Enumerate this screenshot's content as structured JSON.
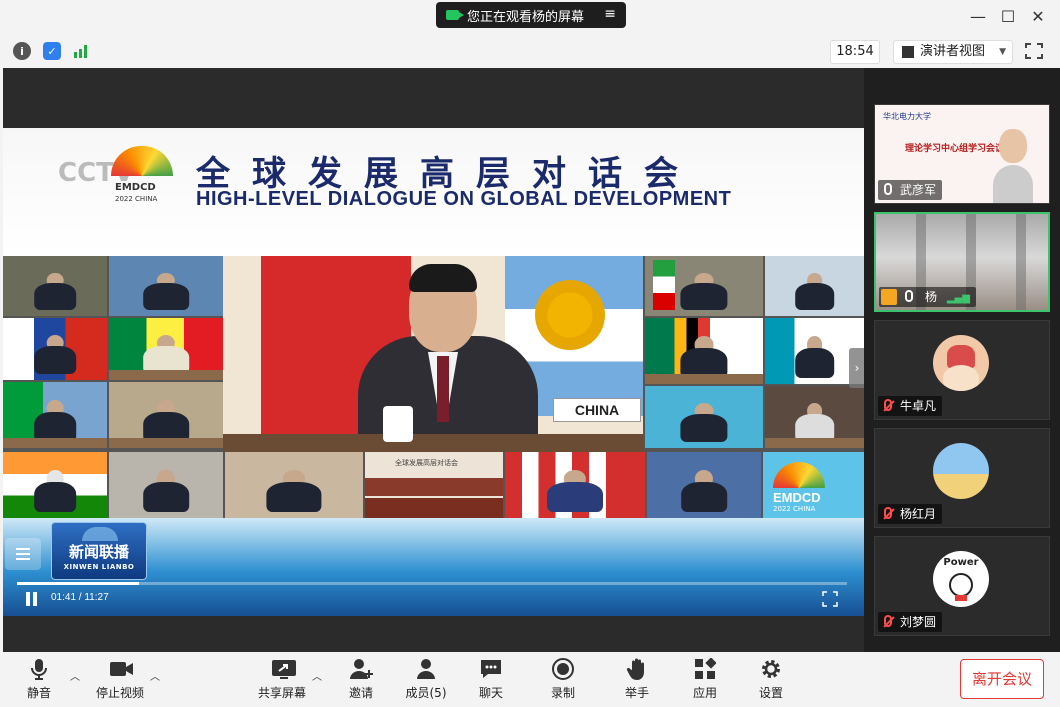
{
  "titlebar": {
    "share_notice": "您正在观看杨的屏幕",
    "menu_icon": "≡",
    "minimize": "—",
    "maximize": "☐",
    "close": "✕"
  },
  "infobar": {
    "time": "18:54",
    "view_mode": "演讲者视图"
  },
  "shared_screen": {
    "channel_logo": "CCTV",
    "event_logo_text": "EMDCD",
    "event_logo_sub": "2022 CHINA",
    "banner_title_cn": "全球发展高层对话会",
    "banner_title_en": "HIGH-LEVEL DIALOGUE ON GLOBAL DEVELOPMENT",
    "name_plate": "CHINA",
    "tile_emdcd": "EMDCD",
    "tile_emdcd_sub": "2022 CHINA",
    "mini_banner": "全球发展高层对话会",
    "news_logo_cn": "新闻联播",
    "news_logo_en": "XINWEN LIANBO",
    "playback_time": "01:41 / 11:27",
    "progress": 0.147
  },
  "participants": [
    {
      "name": "武彦军",
      "muted": false
    },
    {
      "name": "杨",
      "muted": false
    },
    {
      "name": "牛卓凡",
      "muted": true
    },
    {
      "name": "杨红月",
      "muted": true
    },
    {
      "name": "刘梦圆",
      "muted": true
    }
  ],
  "participant_tile1": {
    "logo_text": "华北电力大学",
    "caption": "理论学习中心组学习会议"
  },
  "participant_tile5": {
    "avatar_text": "Power"
  },
  "toolbar": {
    "mute": "静音",
    "stop_video": "停止视频",
    "share_screen": "共享屏幕",
    "invite": "邀请",
    "members": "成员(5)",
    "chat": "聊天",
    "record": "录制",
    "raise_hand": "举手",
    "apps": "应用",
    "settings": "设置",
    "leave": "离开会议"
  },
  "colors": {
    "accent_green": "#3cc36b",
    "leave_red": "#e53935"
  }
}
